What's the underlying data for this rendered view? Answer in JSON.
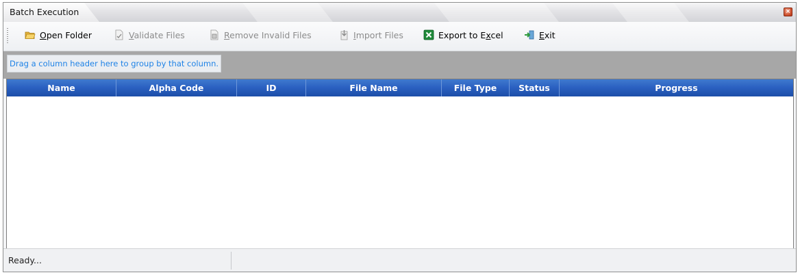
{
  "window": {
    "title": "Batch Execution"
  },
  "toolbar": {
    "open_folder": {
      "pre": "",
      "key": "O",
      "post": "pen Folder"
    },
    "validate_files": {
      "pre": "",
      "key": "V",
      "post": "alidate Files"
    },
    "remove_invalid": {
      "pre": "",
      "key": "R",
      "post": "emove Invalid Files"
    },
    "import_files": {
      "pre": "",
      "key": "I",
      "post": "mport Files"
    },
    "export_excel": {
      "pre": "Export to E",
      "key": "x",
      "post": "cel"
    },
    "exit": {
      "pre": "",
      "key": "E",
      "post": "xit"
    }
  },
  "group_panel": {
    "hint": "Drag a column header here to group by that column."
  },
  "grid": {
    "columns": [
      "Name",
      "Alpha Code",
      "ID",
      "File Name",
      "File Type",
      "Status",
      "Progress"
    ],
    "rows": []
  },
  "status_bar": {
    "text": "Ready..."
  },
  "colors": {
    "header_blue": "#2a5fc0",
    "group_panel_gray": "#a7a7a7",
    "hint_text_blue": "#1e82e6",
    "excel_green": "#1f8a3a"
  }
}
